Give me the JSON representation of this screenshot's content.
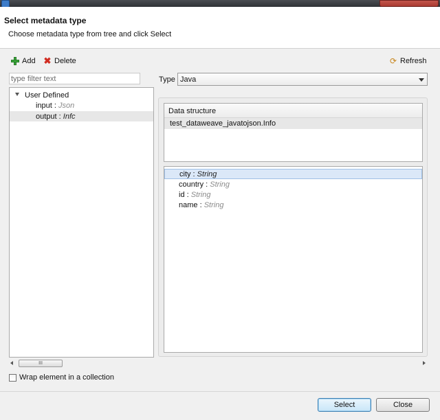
{
  "dialog": {
    "title": "Select metadata type",
    "description": "Choose metadata type from tree and click Select"
  },
  "toolbar": {
    "add_label": "Add",
    "delete_label": "Delete",
    "refresh_label": "Refresh"
  },
  "filter": {
    "placeholder": "type filter text",
    "value": ""
  },
  "tree": {
    "root_label": "User Defined",
    "items": [
      {
        "name": "input",
        "sep": " : ",
        "type": "Json"
      },
      {
        "name": "output",
        "sep": " : ",
        "type": "Infc"
      }
    ],
    "selected": "output"
  },
  "type_selector": {
    "label": "Type",
    "selected_value": "Java"
  },
  "data_structure": {
    "header": "Data structure",
    "rows": [
      "test_dataweave_javatojson.Info"
    ]
  },
  "fields": [
    {
      "name": "city",
      "sep": " : ",
      "type": "String",
      "selected": true
    },
    {
      "name": "country",
      "sep": " : ",
      "type": "String",
      "selected": false
    },
    {
      "name": "id",
      "sep": " : ",
      "type": "String",
      "selected": false
    },
    {
      "name": "name",
      "sep": " : ",
      "type": "String",
      "selected": false
    }
  ],
  "scrollbar": {
    "thumb_grip": "III"
  },
  "options": {
    "wrap_label": "Wrap element in a collection",
    "wrap_checked": false
  },
  "buttons": {
    "select_label": "Select",
    "close_label": "Close"
  },
  "icons": {
    "add": "plus-icon",
    "delete": "red-x-icon",
    "refresh": "refresh-icon"
  }
}
